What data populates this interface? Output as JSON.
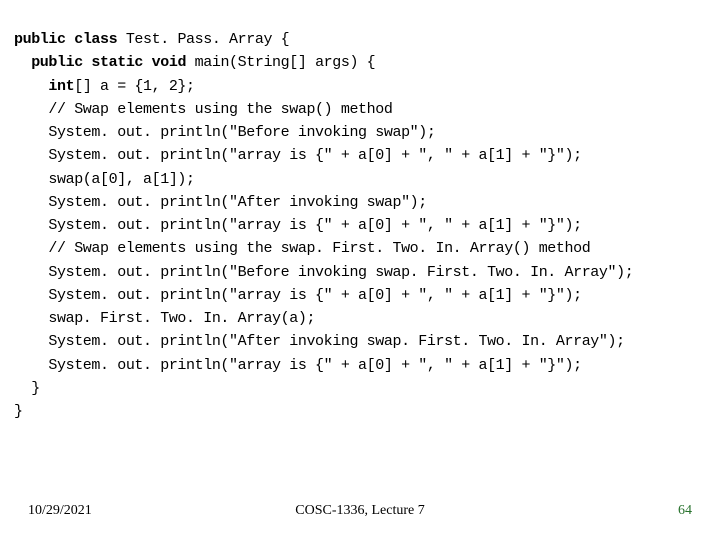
{
  "code": {
    "kw_public1": "public",
    "kw_class": "class",
    "classname_rest": " Test. Pass. Array {",
    "kw_public2": "public",
    "kw_static": "static",
    "kw_void": "void",
    "main_rest": " main(String[] args) {",
    "kw_int": "int",
    "line_decl_rest": "[] a = {1, 2};",
    "line_c1": "// Swap elements using the swap() method",
    "line_p1": "System. out. println(\"Before invoking swap\");",
    "line_p2": "System. out. println(\"array is {\" + a[0] + \", \" + a[1] + \"}\");",
    "line_sw": "swap(a[0], a[1]);",
    "line_p3": "System. out. println(\"After invoking swap\");",
    "line_p4": "System. out. println(\"array is {\" + a[0] + \", \" + a[1] + \"}\");",
    "line_c2": "// Swap elements using the swap. First. Two. In. Array() method",
    "line_p5": "System. out. println(\"Before invoking swap. First. Two. In. Array\");",
    "line_p6": "System. out. println(\"array is {\" + a[0] + \", \" + a[1] + \"}\");",
    "line_sw2": "swap. First. Two. In. Array(a);",
    "line_p7": "System. out. println(\"After invoking swap. First. Two. In. Array\");",
    "line_p8": "System. out. println(\"array is {\" + a[0] + \", \" + a[1] + \"}\");",
    "line_close1": "  }",
    "line_close2": "}"
  },
  "footer": {
    "date": "10/29/2021",
    "title": "COSC-1336, Lecture 7",
    "page": "64"
  }
}
